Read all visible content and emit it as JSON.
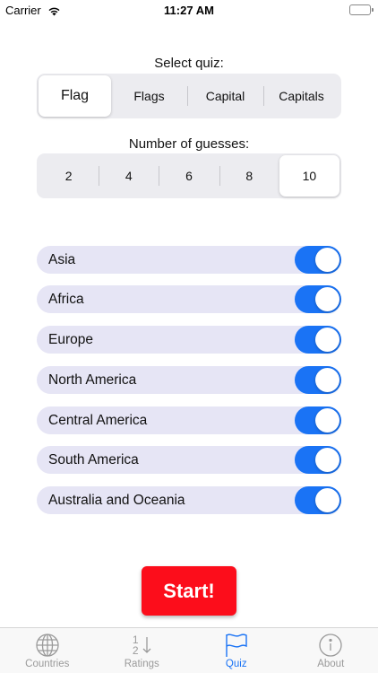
{
  "status_bar": {
    "carrier": "Carrier",
    "time": "11:27 AM"
  },
  "quiz_select": {
    "label": "Select quiz:",
    "options": [
      "Flag",
      "Flags",
      "Capital",
      "Capitals"
    ],
    "selected": "Flag"
  },
  "guesses_select": {
    "label": "Number of guesses:",
    "options": [
      "2",
      "4",
      "6",
      "8",
      "10"
    ],
    "selected": "10"
  },
  "regions": [
    {
      "label": "Asia",
      "enabled": true
    },
    {
      "label": "Africa",
      "enabled": true
    },
    {
      "label": "Europe",
      "enabled": true
    },
    {
      "label": "North America",
      "enabled": true
    },
    {
      "label": "Central America",
      "enabled": true
    },
    {
      "label": "South America",
      "enabled": true
    },
    {
      "label": "Australia and Oceania",
      "enabled": true
    }
  ],
  "start_button": {
    "label": "Start!"
  },
  "tab_bar": {
    "tabs": [
      {
        "label": "Countries",
        "icon": "globe-icon",
        "active": false
      },
      {
        "label": "Ratings",
        "icon": "ratings-sort-icon",
        "icon_text": [
          "1",
          "2"
        ],
        "active": false
      },
      {
        "label": "Quiz",
        "icon": "flag-icon",
        "active": true
      },
      {
        "label": "About",
        "icon": "info-icon",
        "active": false
      }
    ]
  },
  "colors": {
    "accent": "#1a73f5",
    "start_button": "#fc0d1b",
    "region_row_bg": "#e6e5f5",
    "tab_inactive": "#9a9a9a"
  }
}
